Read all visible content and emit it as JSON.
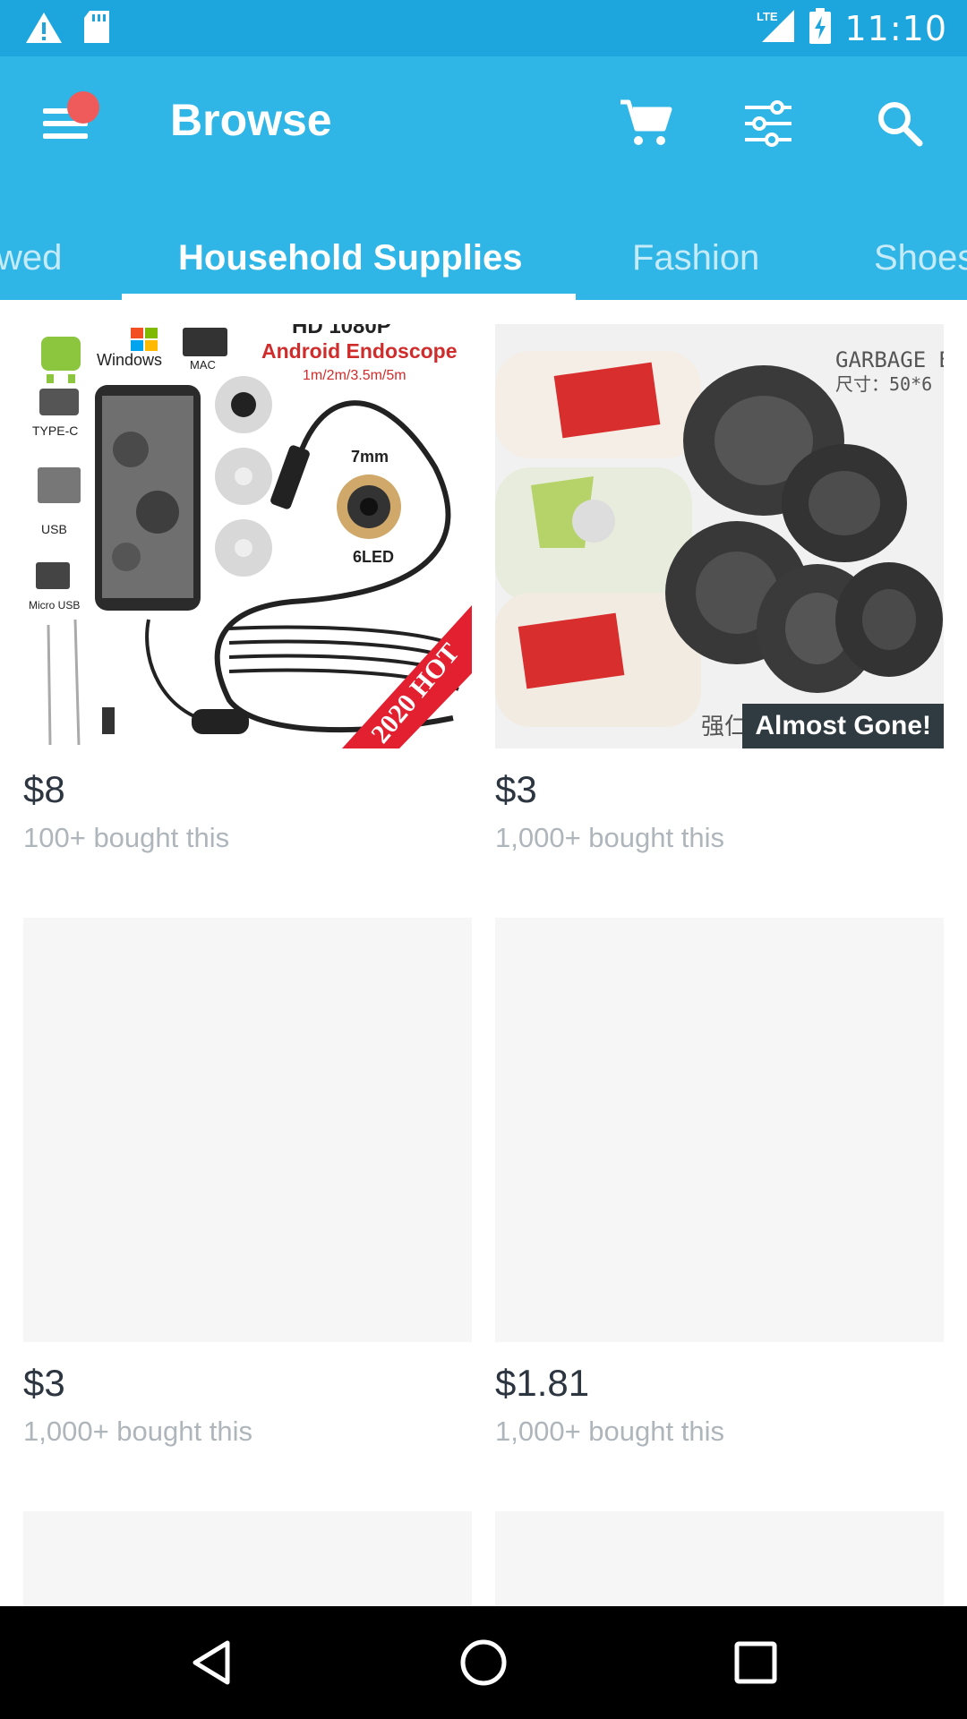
{
  "status_bar": {
    "time": "11:10",
    "network": "LTE",
    "icons": [
      "warning-icon",
      "sd-card-icon",
      "signal-icon",
      "battery-charging-icon"
    ]
  },
  "app_bar": {
    "title": "Browse",
    "actions": [
      "cart-icon",
      "filter-icon",
      "search-icon"
    ],
    "menu_notification_color": "#ef5b5b"
  },
  "tabs": [
    {
      "label": "wed",
      "active": false
    },
    {
      "label": "Household Supplies",
      "active": true
    },
    {
      "label": "Fashion",
      "active": false
    },
    {
      "label": "Shoes",
      "active": false
    }
  ],
  "products": [
    {
      "price": "$8",
      "bought": "100+ bought this",
      "image": "endoscope-image",
      "badge": ""
    },
    {
      "price": "$3",
      "bought": "1,000+ bought this",
      "image": "garbage-bags-image",
      "badge": "Almost Gone!"
    },
    {
      "price": "$3",
      "bought": "1,000+ bought this",
      "image": "placeholder",
      "badge": ""
    },
    {
      "price": "$1.81",
      "bought": "1,000+ bought this",
      "image": "placeholder",
      "badge": ""
    }
  ],
  "product_image_text": {
    "endoscope": {
      "title_line": "HD 1080P",
      "subtitle": "Android Endoscope",
      "lengths": "1m/2m/3.5m/5m",
      "windows": "Windows",
      "mac": "MAC",
      "type_c": "TYPE-C",
      "usb": "USB",
      "micro_usb": "Micro USB",
      "diameter": "7mm",
      "leds": "6LED",
      "ribbon": "2020 HOT"
    },
    "garbage": {
      "header": "GARBAGE B",
      "size": "尺寸：50*6",
      "footer": "强仁"
    }
  },
  "colors": {
    "status_bar": "#1da6de",
    "app_bar": "#2fb5e6",
    "price": "#2d3640",
    "muted": "#aeb5bb",
    "badge": "#2f3b40"
  },
  "nav_bar": [
    "back-icon",
    "home-icon",
    "recents-icon"
  ]
}
